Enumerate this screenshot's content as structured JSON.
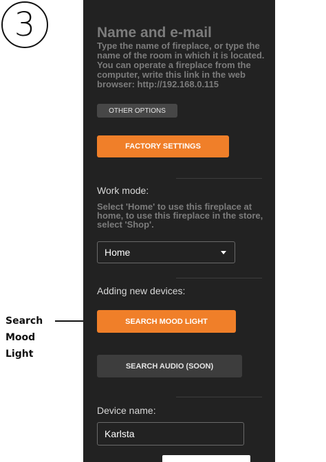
{
  "step": {
    "number": "3"
  },
  "callout": {
    "label": "Search\nMood\nLight"
  },
  "screen": {
    "title": "Name and e-mail",
    "description": "Type the name of fireplace, or type the name of the room in which it is located. You can operate a fireplace from the computer, write this link in the web browser: http://192.168.0.115",
    "other_options_label": "OTHER OPTIONS",
    "factory_settings_label": "FACTORY SETTINGS",
    "work_mode": {
      "label": "Work mode:",
      "help": "Select 'Home' to use this fireplace at home, to use this fireplace in the store, select 'Shop'.",
      "selected": "Home"
    },
    "adding_devices": {
      "label": "Adding new devices:",
      "search_mood_label": "SEARCH MOOD LIGHT",
      "search_audio_label": "SEARCH AUDIO (SOON)"
    },
    "device_name": {
      "label": "Device name:",
      "value": "Karlsta"
    }
  },
  "colors": {
    "background": "#222222",
    "accent": "#f07f29",
    "muted_text": "#7c7c7c"
  }
}
